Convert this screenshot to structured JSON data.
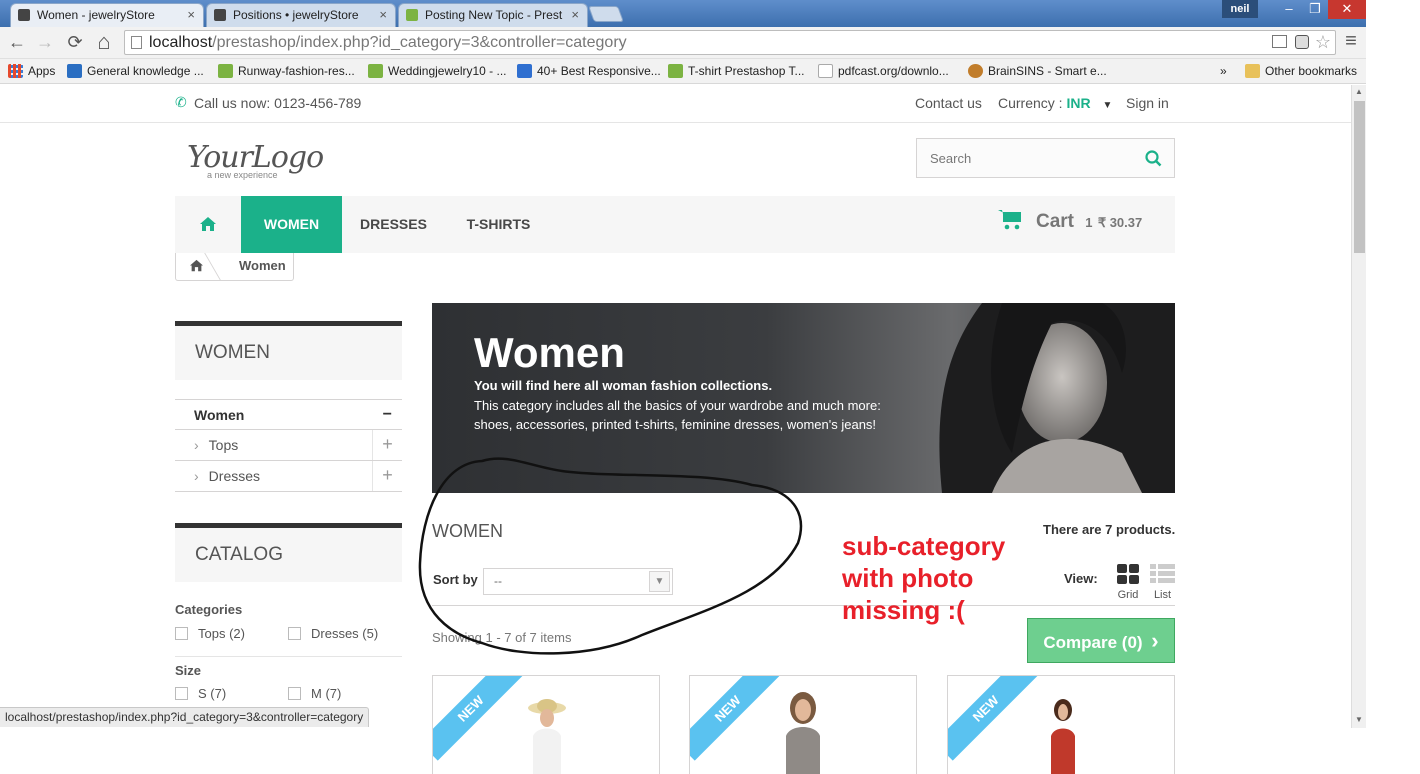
{
  "browser": {
    "tabs": [
      {
        "title": "Women - jewelryStore",
        "close": "×"
      },
      {
        "title": "Positions • jewelryStore",
        "close": "×"
      },
      {
        "title": "Posting New Topic - Prest",
        "close": "×"
      }
    ],
    "user": "neil",
    "window_buttons": {
      "minimize": "–",
      "restore": "❐",
      "close": "✕"
    },
    "url_host": "localhost",
    "url_path": "/prestashop/index.php?id_category=3&controller=category",
    "status_url": "localhost/prestashop/index.php?id_category=3&controller=category",
    "nav": {
      "back": "←",
      "forward": "→",
      "reload": "⟳",
      "home": "⌂",
      "menu": "≡",
      "star": "☆"
    }
  },
  "bookmarks": {
    "items": [
      "Apps",
      "General knowledge ...",
      "Runway-fashion-res...",
      "Weddingjewelry10 - ...",
      "40+ Best Responsive...",
      "T-shirt Prestashop T...",
      "pdfcast.org/downlo...",
      "BrainSINS - Smart e..."
    ],
    "more": "»",
    "other": "Other bookmarks",
    "colors": [
      "#e6492d",
      "#3b7bd6",
      "#7cb342",
      "#7cb342",
      "#2f6fd0",
      "#7cb342",
      "#d9534f",
      "#c17d2b"
    ]
  },
  "store": {
    "call_label": "Call us now:",
    "phone": "0123-456-789",
    "contact": "Contact us",
    "currency_label": "Currency :",
    "currency": "INR",
    "signin": "Sign in",
    "logo": "YourLogo",
    "logo_tagline": "a new experience",
    "search_placeholder": "Search",
    "menu": [
      "WOMEN",
      "DRESSES",
      "T-SHIRTS"
    ],
    "cart_label": "Cart",
    "cart_count": "1",
    "cart_total": "₹ 30.37",
    "breadcrumb": "Women",
    "accent": "#1bb18a"
  },
  "sidebar": {
    "title": "WOMEN",
    "active": "Women",
    "active_toggle": "−",
    "items": [
      {
        "label": "Tops",
        "toggle": "+"
      },
      {
        "label": "Dresses",
        "toggle": "+"
      }
    ],
    "chevron": "›",
    "catalog_title": "CATALOG",
    "categories_label": "Categories",
    "categories": [
      "Tops (2)",
      "Dresses (5)"
    ],
    "size_label": "Size",
    "sizes": [
      "S (7)",
      "M (7)"
    ]
  },
  "category": {
    "banner_title": "Women",
    "banner_lead": "You will find here all woman fashion collections.",
    "banner_text1": "This category includes all the basics of your wardrobe and much more:",
    "banner_text2": "shoes, accessories, printed t-shirts, feminine dresses, women's jeans!",
    "heading": "WOMEN",
    "product_count": "There are 7 products.",
    "sort_label": "Sort by",
    "sort_value": "--",
    "view_label": "View:",
    "grid": "Grid",
    "list": "List",
    "showing": "Showing 1 - 7 of 7 items",
    "compare": "Compare (0)",
    "compare_arrow": "›",
    "new_badge": "New"
  },
  "annotation": {
    "line1": "sub-category",
    "line2": "with photo",
    "line3": "missing :("
  }
}
